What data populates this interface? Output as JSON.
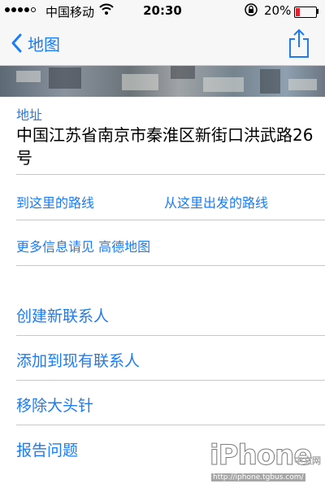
{
  "status_bar": {
    "carrier": "中国移动",
    "time": "20:30",
    "battery_percent": "20%",
    "battery_level": 0.2,
    "battery_color": "#e3202f",
    "icons": [
      "signal-dots",
      "wifi-icon",
      "rotation-lock-icon",
      "battery-icon"
    ]
  },
  "nav": {
    "back_label": "地图",
    "share_icon": "share-icon",
    "accent_color": "#1b7cf5"
  },
  "address": {
    "label": "地址",
    "value": "中国江苏省南京市秦淮区新街口洪武路26号"
  },
  "directions": {
    "to_here": "到这里的路线",
    "from_here": "从这里出发的路线"
  },
  "more_info": "更多信息请见 高德地图",
  "actions": [
    {
      "label": "创建新联系人"
    },
    {
      "label": "添加到现有联系人"
    },
    {
      "label": "移除大头针"
    },
    {
      "label": "报告问题"
    }
  ],
  "watermark": {
    "logo": "iPhone",
    "logo_cn": "中文网",
    "url": "http://iphone.tgbus.com/"
  }
}
